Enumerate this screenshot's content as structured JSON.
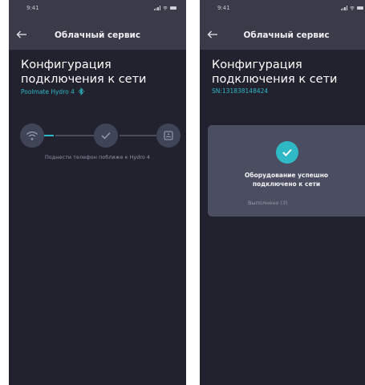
{
  "screens": [
    {
      "status_time": "9:41",
      "nav_title": "Облачный сервис",
      "heading_line1": "Конфигурация",
      "heading_line2": "подключения к сети",
      "device_label": "Poolmate  Hydro 4",
      "hint": "Поднести телефон поближе к Hydro 4"
    },
    {
      "status_time": "9:41",
      "nav_title": "Облачный сервис",
      "heading_line1": "Конфигурация",
      "heading_line2": "подключения к сети",
      "serial": "SN:131838148424",
      "success_line1": "Оборудование успешно",
      "success_line2": "подключено к сети",
      "status_text": "Выполнено (3)"
    }
  ],
  "colors": {
    "accent": "#2fb8c6",
    "background": "#22222f",
    "topbar": "#3a3a49",
    "card": "#4a4e60"
  },
  "icons": [
    "back-arrow-icon",
    "bluetooth-icon",
    "wifi-icon",
    "check-icon",
    "router-icon"
  ]
}
